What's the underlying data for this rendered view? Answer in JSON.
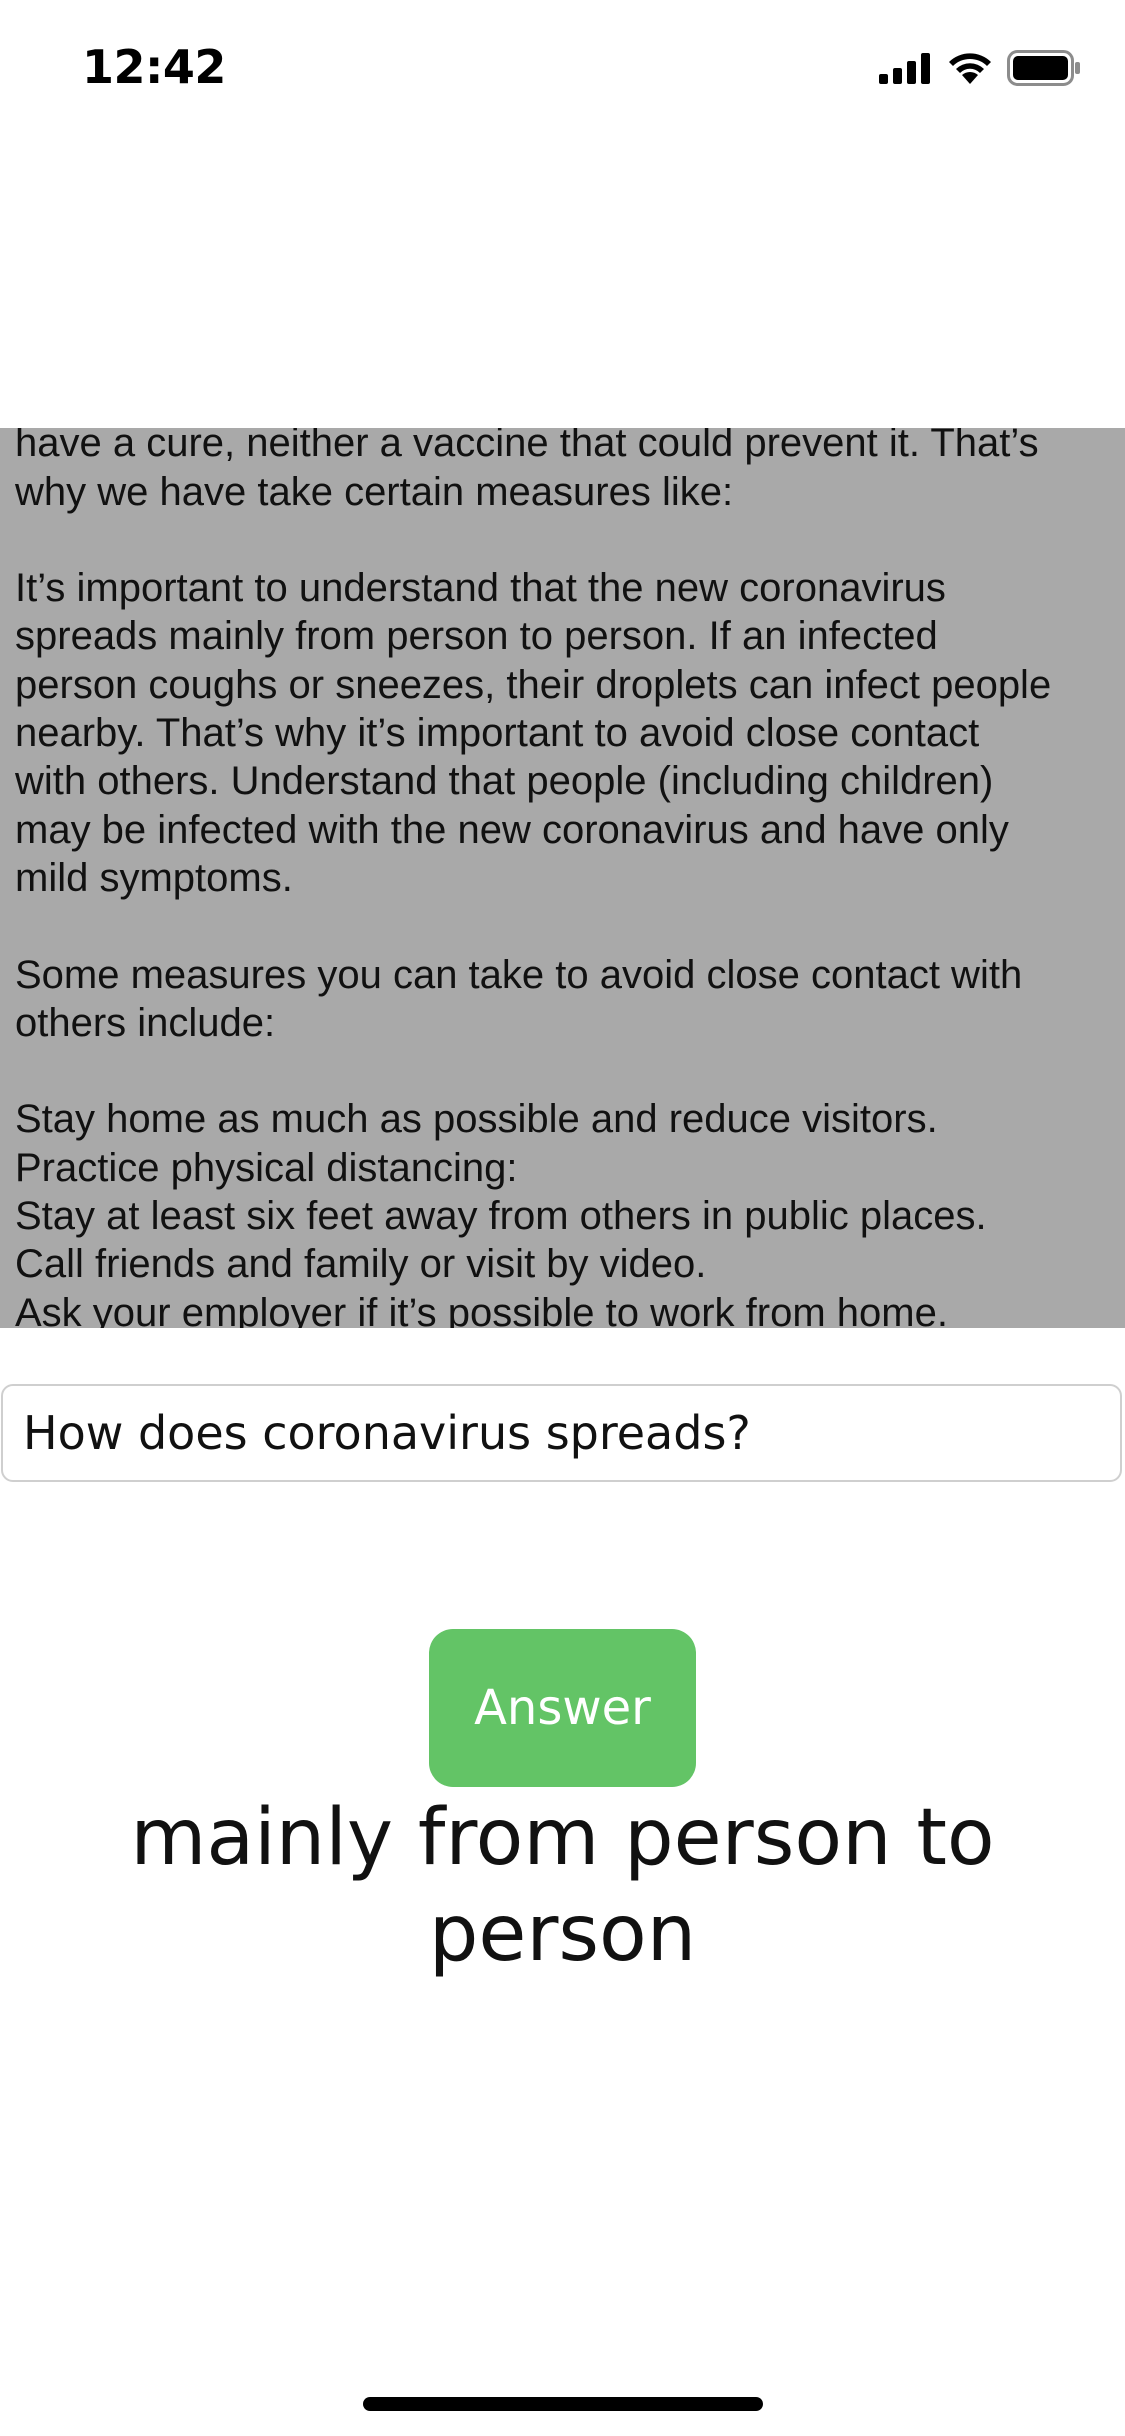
{
  "status_bar": {
    "time": "12:42",
    "icons": [
      "signal-icon",
      "wifi-icon",
      "battery-icon"
    ]
  },
  "context": {
    "text": "country is working hard on finding, but currently we don't\nhave a cure, neither a vaccine that could prevent it. That’s\nwhy we have take certain measures like:\n\nIt’s important to understand that the new coronavirus\nspreads mainly from person to person. If an infected\nperson coughs or sneezes, their droplets can infect people\nnearby. That’s why it’s important to avoid close contact\nwith others. Understand that people (including children)\nmay be infected with the new coronavirus and have only\nmild symptoms.\n\nSome measures you can take to avoid close contact with\nothers include:\n\nStay home as much as possible and reduce visitors.\nPractice physical distancing:\nStay at least six feet away from others in public places.\nCall friends and family or visit by video.\nAsk your employer if it’s possible to work from home."
  },
  "question": {
    "value": "How does coronavirus spreads?"
  },
  "answer_button": {
    "label": "Answer"
  },
  "answer": {
    "text": "mainly from person to person"
  },
  "colors": {
    "context_background": "#a9a9a9",
    "button_green": "#63c466"
  }
}
